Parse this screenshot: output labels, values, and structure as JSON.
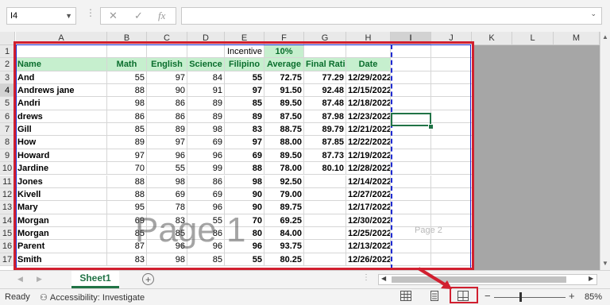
{
  "formula_bar": {
    "name_box": "I4",
    "cancel_icon": "✕",
    "enter_icon": "✓",
    "fx_label": "fx",
    "formula": ""
  },
  "columns": [
    "A",
    "B",
    "C",
    "D",
    "E",
    "F",
    "G",
    "H",
    "I",
    "J",
    "K",
    "L",
    "M"
  ],
  "selected_column": "I",
  "selected_cell": "I4",
  "rows": [
    {
      "n": "1",
      "cells": {
        "E": "Incentive",
        "F": "10%"
      }
    },
    {
      "n": "2",
      "cells": {
        "A": "Name",
        "B": "Math",
        "C": "English",
        "D": "Science",
        "E": "Filipino",
        "F": "Average",
        "G": "Final Rating",
        "H": "Date"
      }
    },
    {
      "n": "3",
      "cells": {
        "A": "And",
        "B": "55",
        "C": "97",
        "D": "84",
        "E": "55",
        "F": "72.75",
        "G": "77.29",
        "H": "12/29/2022"
      }
    },
    {
      "n": "4",
      "cells": {
        "A": "Andrews jane",
        "B": "88",
        "C": "90",
        "D": "91",
        "E": "97",
        "F": "91.50",
        "G": "92.48",
        "H": "12/15/2022"
      }
    },
    {
      "n": "5",
      "cells": {
        "A": "Andri",
        "B": "98",
        "C": "86",
        "D": "89",
        "E": "85",
        "F": "89.50",
        "G": "87.48",
        "H": "12/18/2022"
      }
    },
    {
      "n": "6",
      "cells": {
        "A": "drews",
        "B": "86",
        "C": "86",
        "D": "89",
        "E": "89",
        "F": "87.50",
        "G": "87.98",
        "H": "12/23/2022"
      }
    },
    {
      "n": "7",
      "cells": {
        "A": "Gill",
        "B": "85",
        "C": "89",
        "D": "98",
        "E": "83",
        "F": "88.75",
        "G": "89.79",
        "H": "12/21/2022"
      }
    },
    {
      "n": "8",
      "cells": {
        "A": "How",
        "B": "89",
        "C": "97",
        "D": "69",
        "E": "97",
        "F": "88.00",
        "G": "87.85",
        "H": "12/22/2022"
      }
    },
    {
      "n": "9",
      "cells": {
        "A": "Howard",
        "B": "97",
        "C": "96",
        "D": "96",
        "E": "69",
        "F": "89.50",
        "G": "87.73",
        "H": "12/19/2022"
      }
    },
    {
      "n": "10",
      "cells": {
        "A": "Jardine",
        "B": "70",
        "C": "55",
        "D": "99",
        "E": "88",
        "F": "78.00",
        "G": "80.10",
        "H": "12/28/2022"
      }
    },
    {
      "n": "11",
      "cells": {
        "A": "Jones",
        "B": "88",
        "C": "98",
        "D": "86",
        "E": "98",
        "F": "92.50",
        "G": "",
        "H": "12/14/2022"
      }
    },
    {
      "n": "12",
      "cells": {
        "A": "Kivell",
        "B": "88",
        "C": "69",
        "D": "69",
        "E": "90",
        "F": "79.00",
        "G": "",
        "H": "12/27/2022"
      }
    },
    {
      "n": "13",
      "cells": {
        "A": "Mary",
        "B": "95",
        "C": "78",
        "D": "96",
        "E": "90",
        "F": "89.75",
        "G": "",
        "H": "12/17/2022"
      }
    },
    {
      "n": "14",
      "cells": {
        "A": "Morgan",
        "B": "69",
        "C": "83",
        "D": "55",
        "E": "70",
        "F": "69.25",
        "G": "",
        "H": "12/30/2022"
      }
    },
    {
      "n": "15",
      "cells": {
        "A": "Morgan",
        "B": "85",
        "C": "85",
        "D": "86",
        "E": "80",
        "F": "84.00",
        "G": "",
        "H": "12/25/2022"
      }
    },
    {
      "n": "16",
      "cells": {
        "A": "Parent",
        "B": "87",
        "C": "96",
        "D": "96",
        "E": "96",
        "F": "93.75",
        "G": "",
        "H": "12/13/2022"
      }
    },
    {
      "n": "17",
      "cells": {
        "A": "Smith",
        "B": "83",
        "C": "98",
        "D": "85",
        "E": "55",
        "F": "80.25",
        "G": "",
        "H": "12/26/2022"
      }
    }
  ],
  "watermarks": {
    "page1": "Page 1",
    "page2": "Page 2"
  },
  "sheet_tabs": {
    "active": "Sheet1",
    "add_label": "+"
  },
  "status": {
    "ready": "Ready",
    "accessibility": "Accessibility: Investigate",
    "zoom": "85%",
    "zoom_minus": "−",
    "zoom_plus": "+"
  },
  "colors": {
    "accent": "#217346",
    "page_border": "#1f2bd1",
    "highlight": "#d11f2f",
    "header_fill": "#c6efce",
    "header_text": "#0a6e2d"
  }
}
